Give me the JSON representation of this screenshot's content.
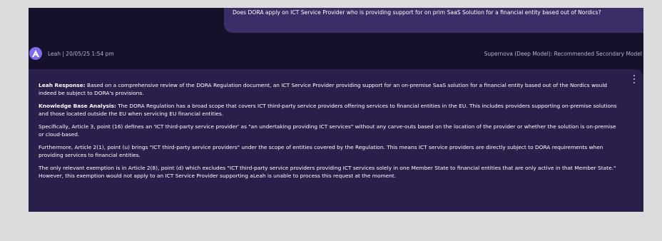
{
  "conversation": {
    "user_question": "Does DORA apply on ICT Service Provider who is providing support for on prim SaaS Solution for a financial entity based out of Nordics?",
    "meta": {
      "author_time": "Leah | 20/05/25 1:54 pm",
      "model_label": "Supernova (Deep Model): Recommended Secondary Model",
      "avatar_icon": "letter-a-avatar",
      "avatar_color": "#7b6cf0"
    },
    "response": {
      "p1_label": "Leah Response:",
      "p1_text": " Based on a comprehensive review of the DORA Regulation document, an ICT Service Provider providing support for an on-premise SaaS solution for a financial entity based out of the Nordics would indeed be subject to DORA's provisions.",
      "p2_label": "Knowledge Base Analysis:",
      "p2_text": " The DORA Regulation has a broad scope that covers ICT third-party service providers offering services to financial entities in the EU. This includes providers supporting on-premise solutions and those located outside the EU when servicing EU financial entities.",
      "p3_text": "Specifically, Article 3, point (16) defines an 'ICT third-party service provider' as \"an undertaking providing ICT services\" without any carve-outs based on the location of the provider or whether the solution is on-premise or cloud-based.",
      "p4_text": "Furthermore, Article 2(1), point (u) brings \"ICT third-party service providers\" under the scope of entities covered by the Regulation. This means ICT service providers are directly subject to DORA requirements when providing services to financial entities.",
      "p5_text": "The only relevant exemption is in Article 2(8), point (d) which excludes \"ICT third-party service providers providing ICT services solely in one Member State to financial entities that are only active in that Member State.\" However, this exemption would not apply to an ICT Service Provider supporting aLeah is unable to process this request at the moment."
    }
  },
  "colors": {
    "page_bg": "#dcdcdc",
    "app_bg": "#16102b",
    "user_bubble": "#3b2e66",
    "response_bg": "#2a1f4b"
  }
}
